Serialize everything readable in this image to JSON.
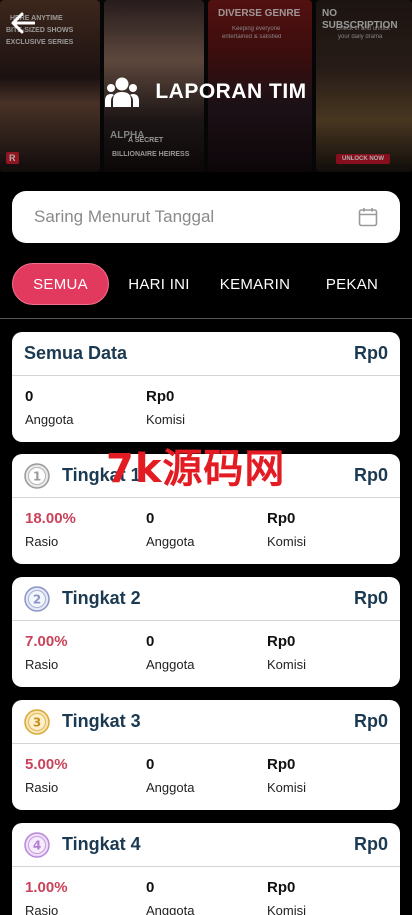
{
  "header": {
    "title": "LAPORAN TIM",
    "banner": {
      "p1_line1": "HERE ANYTIME",
      "p1_line2": "BITE-SIZED SHOWS",
      "p1_line3": "EXCLUSIVE SERIES",
      "p2_line1": "A SECRET",
      "p2_line2": "BILLIONAIRE HEIRESS",
      "p2_tag": "ALPHA",
      "p3_line1": "DIVERSE GENRE",
      "p3_line2": "Keeping everyone",
      "p3_line3": "entertained & satisfied",
      "p4_line1": "NO SUBSCRIPTION",
      "p4_line2": "Check in and unlock",
      "p4_line3": "your daily drama",
      "p4_badge": "UNLOCK NOW",
      "p1_mark": "R"
    }
  },
  "filter": {
    "placeholder": "Saring Menurut Tanggal"
  },
  "tabs": [
    {
      "label": "SEMUA",
      "active": true
    },
    {
      "label": "HARI INI",
      "active": false
    },
    {
      "label": "KEMARIN",
      "active": false
    },
    {
      "label": "PEKAN",
      "active": false
    }
  ],
  "summary": {
    "title": "Semua Data",
    "total": "Rp0",
    "members_value": "0",
    "members_label": "Anggota",
    "commission_value": "Rp0",
    "commission_label": "Komisi"
  },
  "levels": [
    {
      "title": "Tingkat 1",
      "total": "Rp0",
      "ratio": "18.00%",
      "ratio_label": "Rasio",
      "members": "0",
      "members_label": "Anggota",
      "commission": "Rp0",
      "commission_label": "Komisi",
      "medal_digit": "1",
      "medal_color": "#9a9a9a"
    },
    {
      "title": "Tingkat 2",
      "total": "Rp0",
      "ratio": "7.00%",
      "ratio_label": "Rasio",
      "members": "0",
      "members_label": "Anggota",
      "commission": "Rp0",
      "commission_label": "Komisi",
      "medal_digit": "2",
      "medal_color": "#8a96c8"
    },
    {
      "title": "Tingkat 3",
      "total": "Rp0",
      "ratio": "5.00%",
      "ratio_label": "Rasio",
      "members": "0",
      "members_label": "Anggota",
      "commission": "Rp0",
      "commission_label": "Komisi",
      "medal_digit": "3",
      "medal_color": "#d8a838"
    },
    {
      "title": "Tingkat 4",
      "total": "Rp0",
      "ratio": "1.00%",
      "ratio_label": "Rasio",
      "members": "0",
      "members_label": "Anggota",
      "commission": "Rp0",
      "commission_label": "Komisi",
      "medal_digit": "4",
      "medal_color": "#b888d8"
    }
  ],
  "watermark": "7k源码网",
  "colors": {
    "accent": "#e23a5e",
    "title_text": "#1b3a52",
    "ratio_text": "#c9425a"
  }
}
